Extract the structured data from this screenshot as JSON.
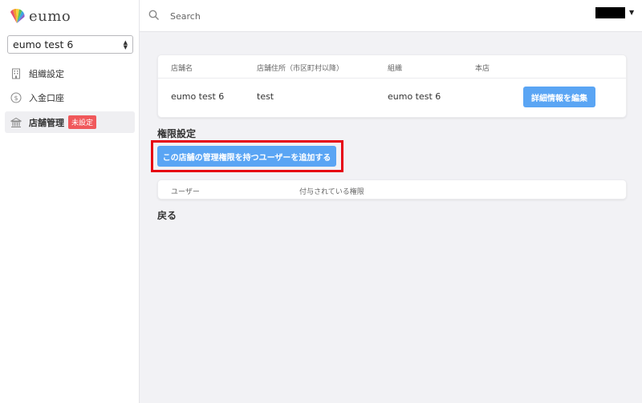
{
  "app": {
    "logo_text": "eumo"
  },
  "sidebar": {
    "store_select_value": "eumo test 6",
    "items": [
      {
        "label": "組織設定",
        "icon": "building-icon"
      },
      {
        "label": "入金口座",
        "icon": "dollar-circle-icon"
      },
      {
        "label": "店舗管理",
        "icon": "bank-icon",
        "badge": "未設定"
      }
    ]
  },
  "header": {
    "search_placeholder": "Search"
  },
  "store_table": {
    "headers": [
      "店舗名",
      "店舗住所（市区町村以降）",
      "組織",
      "本店"
    ],
    "row": {
      "name": "eumo test 6",
      "address": "test",
      "organization": "eumo test 6",
      "head_office": ""
    },
    "edit_button": "詳細情報を編集"
  },
  "permissions": {
    "title": "権限設定",
    "add_button": "この店舗の管理権限を持つユーザーを追加する",
    "headers": [
      "ユーザー",
      "付与されている権限"
    ]
  },
  "back_label": "戻る",
  "colors": {
    "primary": "#5aa5f4",
    "badge": "#f0585b",
    "highlight": "#e60012"
  }
}
